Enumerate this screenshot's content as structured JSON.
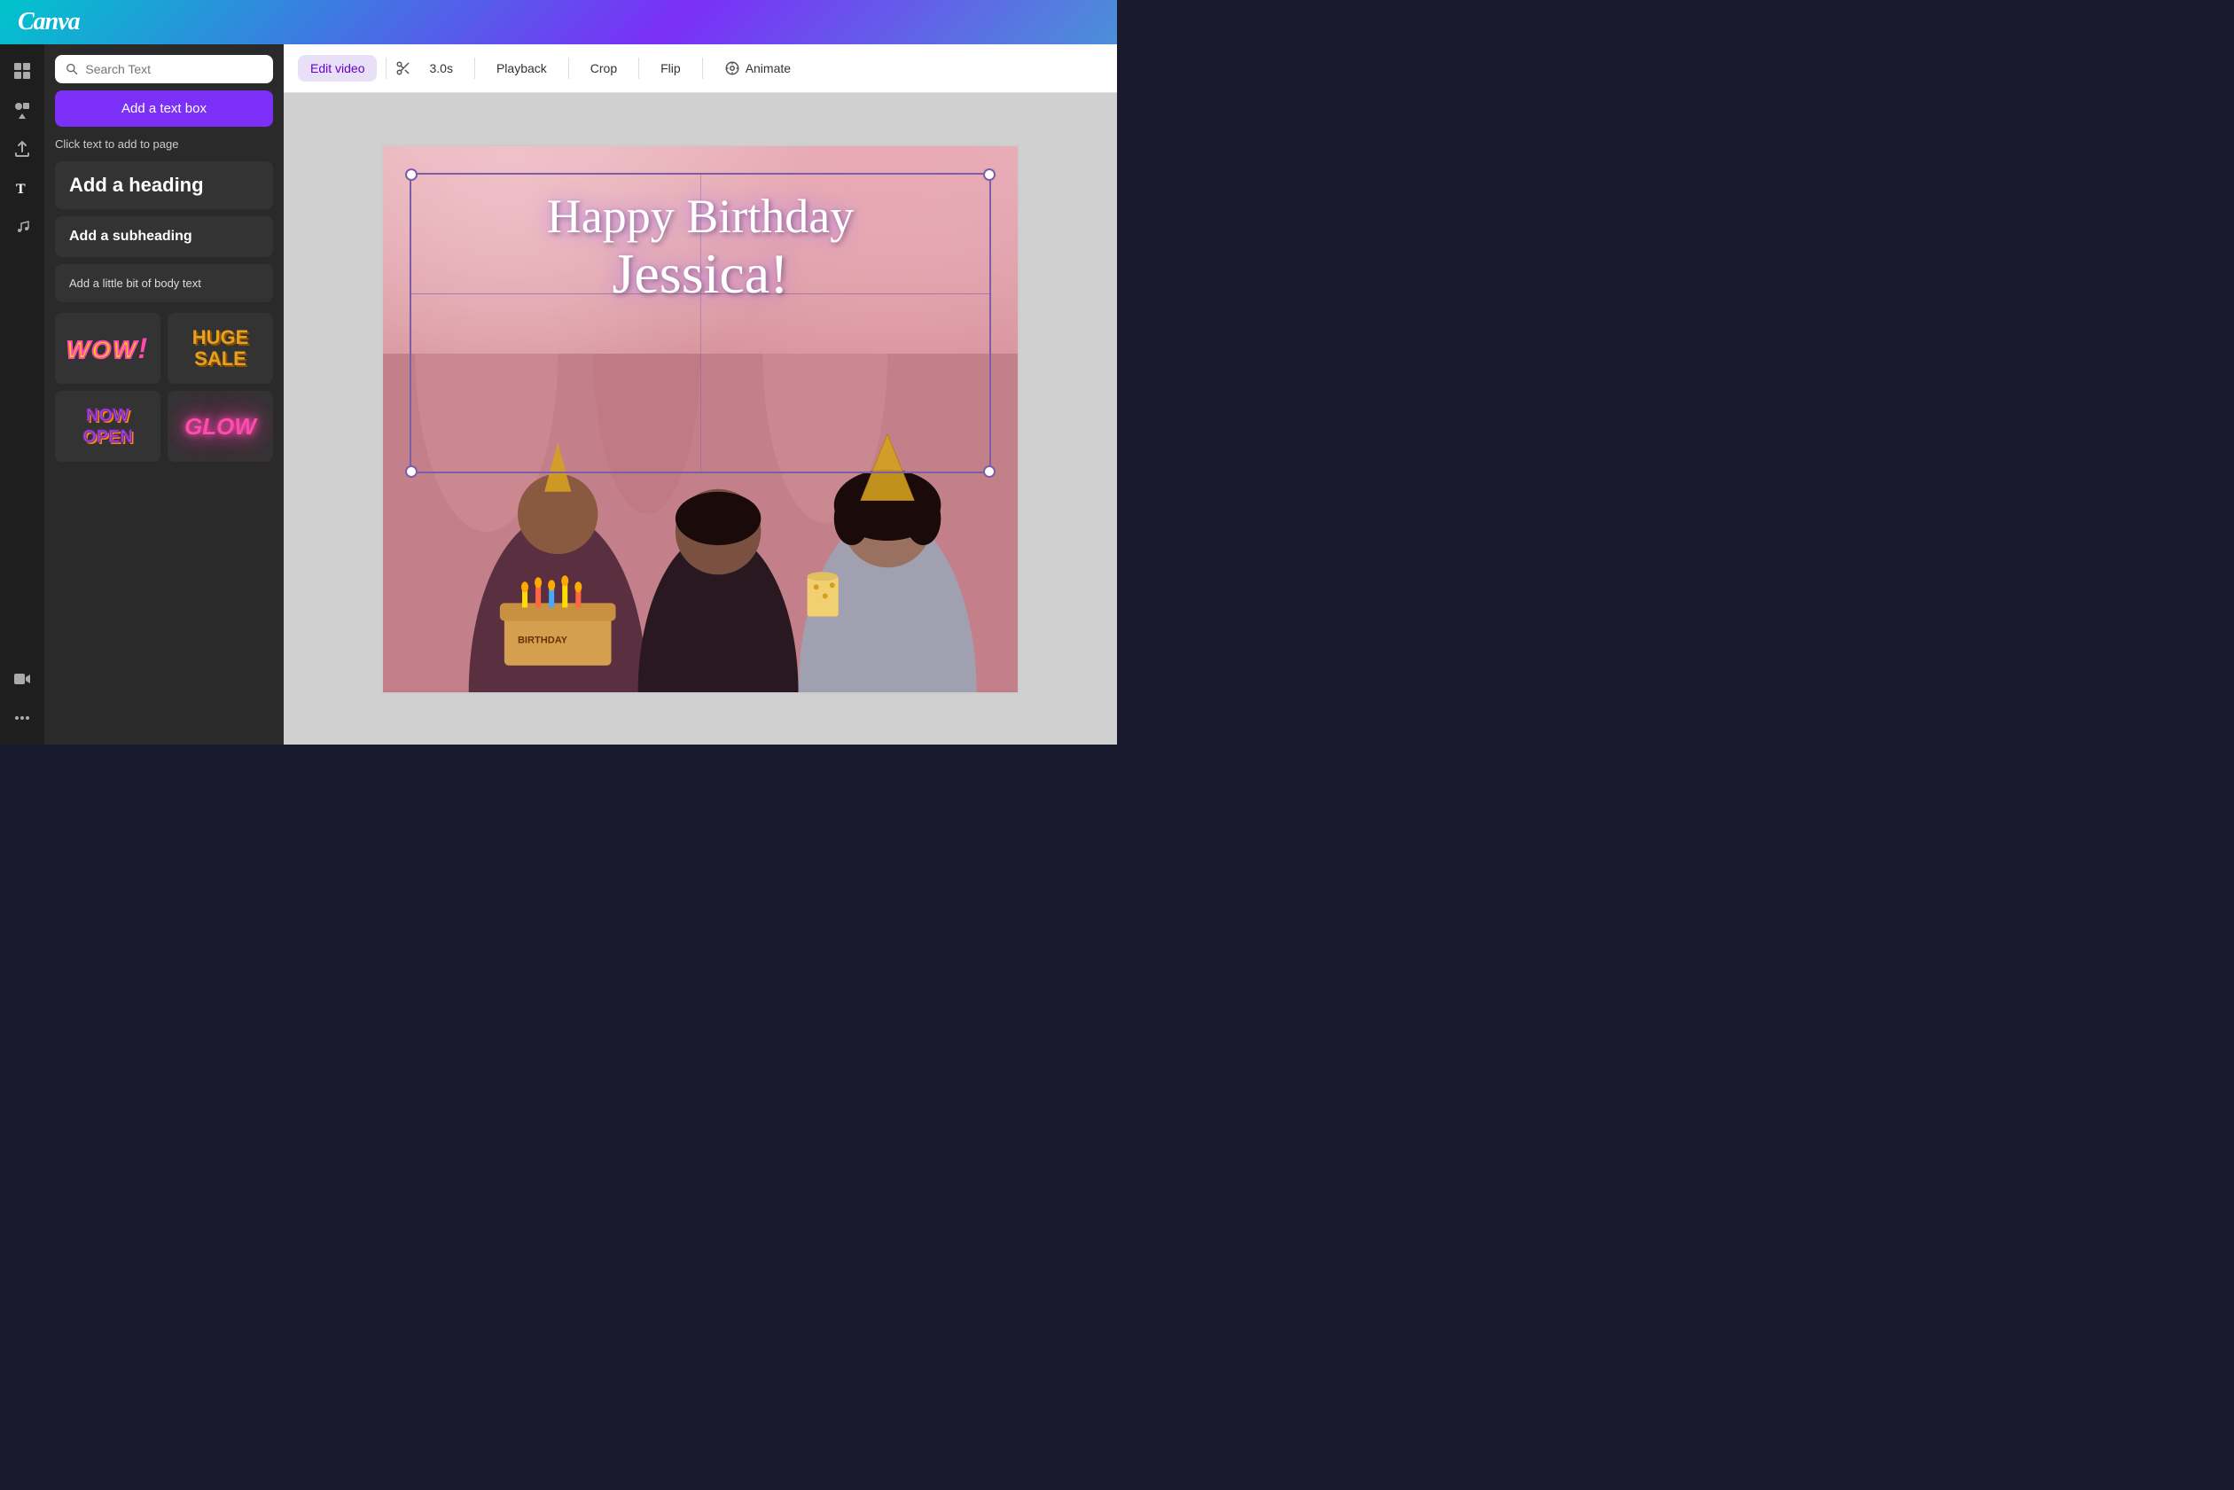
{
  "header": {
    "logo": "Canva"
  },
  "sidebar": {
    "icons": [
      {
        "name": "layout-icon",
        "symbol": "⊞",
        "active": false
      },
      {
        "name": "elements-icon",
        "symbol": "◆",
        "active": false
      },
      {
        "name": "upload-icon",
        "symbol": "↑",
        "active": false
      },
      {
        "name": "text-icon",
        "symbol": "T",
        "active": true
      },
      {
        "name": "audio-icon",
        "symbol": "♪",
        "active": false
      },
      {
        "name": "video-icon",
        "symbol": "▶",
        "active": false
      },
      {
        "name": "more-icon",
        "symbol": "•••",
        "active": false
      }
    ]
  },
  "textPanel": {
    "searchPlaceholder": "Search Text",
    "addTextboxLabel": "Add a text box",
    "clickTextLabel": "Click text to add to page",
    "heading": "Add a heading",
    "subheading": "Add a subheading",
    "bodyText": "Add a little bit of body text",
    "styles": [
      {
        "name": "wow",
        "label": "WOW!"
      },
      {
        "name": "huge-sale",
        "label": "HUGE\nSALE"
      },
      {
        "name": "now-open",
        "label": "NOW\nOPEN"
      },
      {
        "name": "glow",
        "label": "GLOW"
      }
    ]
  },
  "toolbar": {
    "editVideo": "Edit video",
    "duration": "3.0s",
    "playback": "Playback",
    "crop": "Crop",
    "flip": "Flip",
    "animate": "Animate"
  },
  "canvas": {
    "birthdayLine1": "Happy Birthday",
    "birthdayLine2": "Jessica!"
  }
}
